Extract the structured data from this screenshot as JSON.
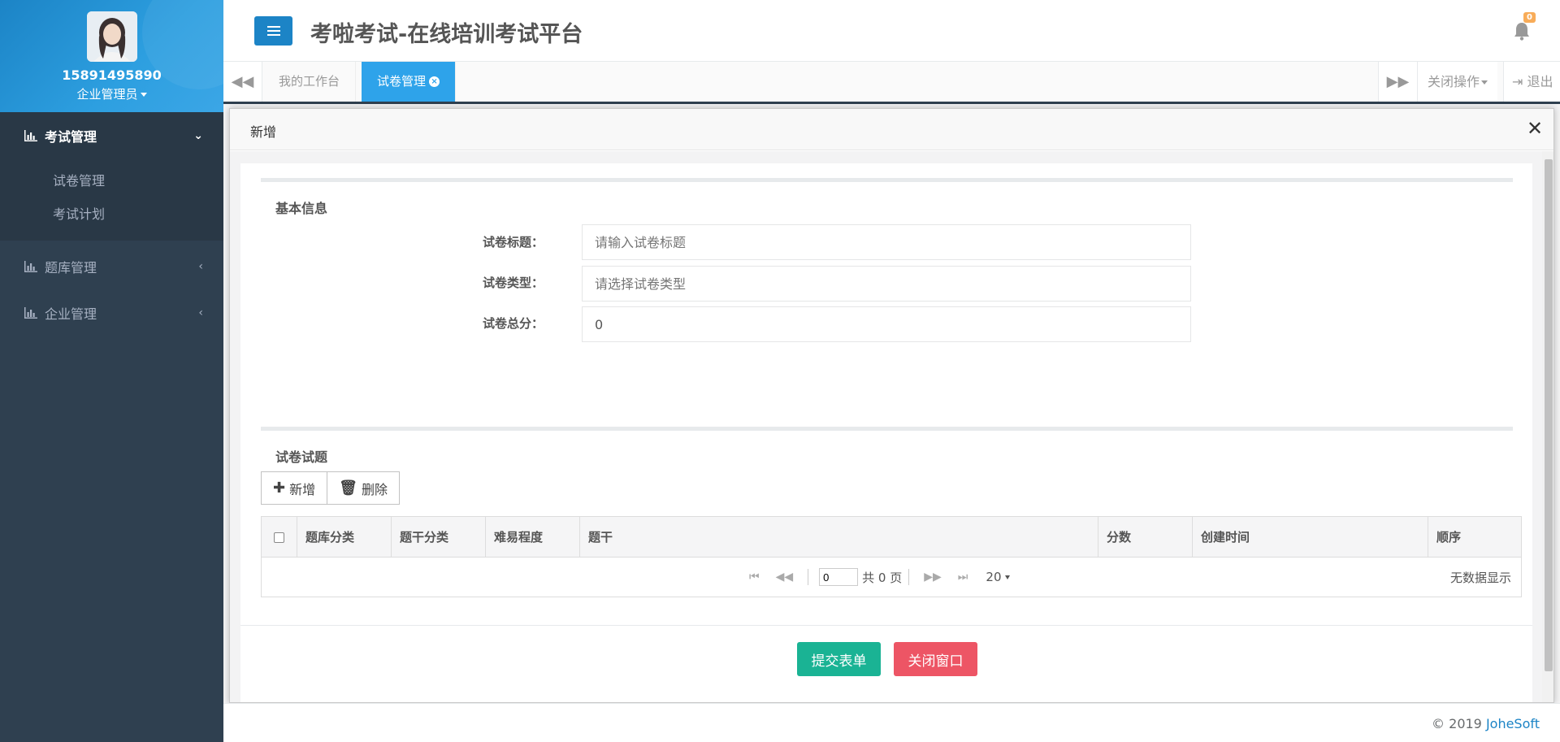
{
  "user": {
    "name": "15891495890",
    "role": "企业管理员"
  },
  "sidebar": {
    "groups": [
      {
        "label": "考试管理",
        "expanded": true,
        "items": [
          {
            "label": "试卷管理"
          },
          {
            "label": "考试计划"
          }
        ]
      },
      {
        "label": "题库管理",
        "expanded": false
      },
      {
        "label": "企业管理",
        "expanded": false
      }
    ]
  },
  "header": {
    "title": "考啦考试-在线培训考试平台",
    "notification_count": "0"
  },
  "tabs": {
    "items": [
      {
        "label": "我的工作台"
      },
      {
        "label": "试卷管理"
      }
    ],
    "close_ops": "关闭操作",
    "logout": "退出"
  },
  "modal": {
    "title": "新增",
    "basic_section": {
      "title": "基本信息",
      "fields": [
        {
          "label": "试卷标题：",
          "value": "",
          "placeholder": "请输入试卷标题"
        },
        {
          "label": "试卷类型：",
          "value": "",
          "placeholder": "请选择试卷类型"
        },
        {
          "label": "试卷总分：",
          "value": "0",
          "placeholder": ""
        }
      ]
    },
    "questions_section": {
      "title": "试卷试题",
      "add_label": "新增",
      "delete_label": "删除",
      "columns": [
        "题库分类",
        "题干分类",
        "难易程度",
        "题干",
        "分数",
        "创建时间",
        "顺序"
      ],
      "pager": {
        "current_page": "0",
        "total_text": "共 0 页",
        "page_size": "20",
        "empty_text": "无数据显示"
      }
    },
    "submit_label": "提交表单",
    "close_label": "关闭窗口"
  },
  "footer": {
    "copyright": "© 2019 ",
    "brand": "JoheSoft"
  },
  "colors": {
    "sidebar_bg": "#2f4050",
    "primary": "#1c84c6",
    "success": "#1ab394",
    "danger": "#ed5565",
    "badge": "#f8ac59"
  }
}
